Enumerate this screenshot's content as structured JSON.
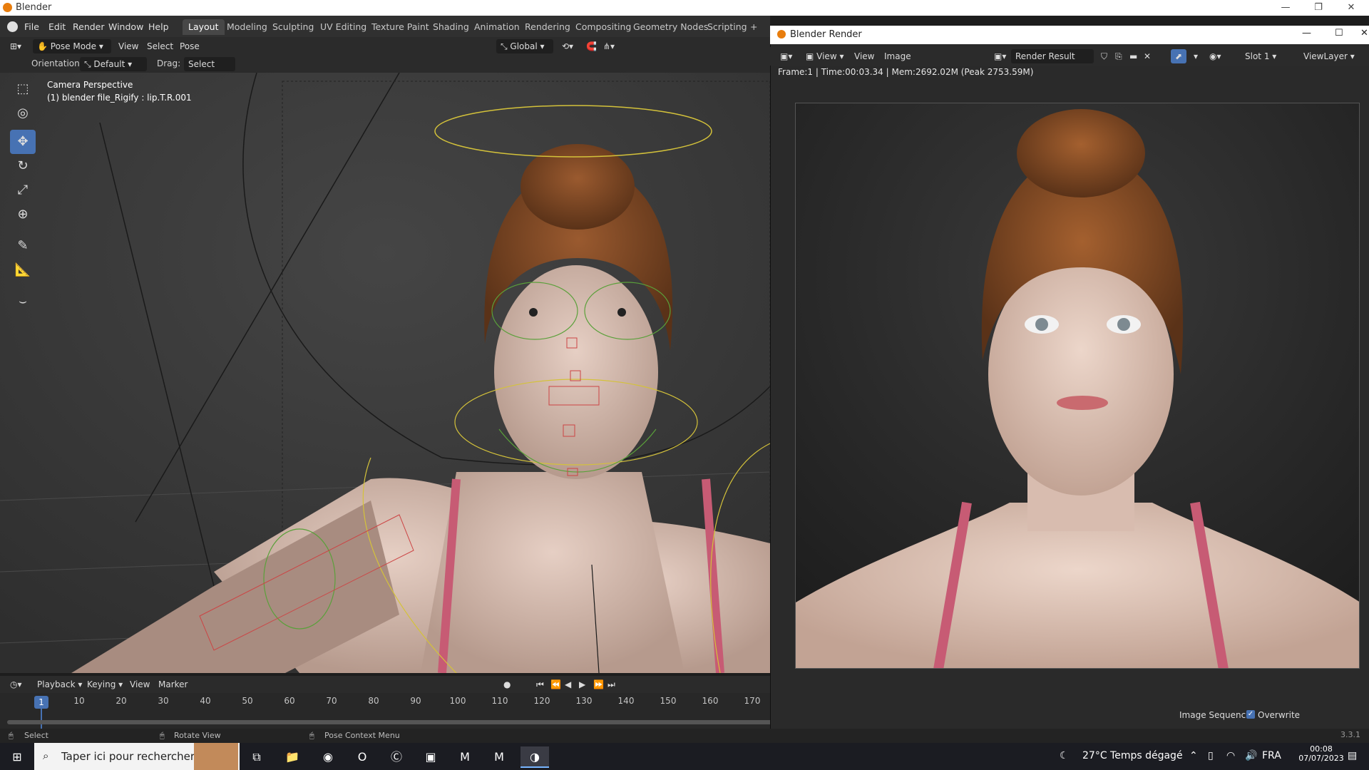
{
  "os": {
    "window_title": "Blender",
    "controls": [
      "—",
      "❐",
      "✕"
    ]
  },
  "menubar": {
    "items": [
      "File",
      "Edit",
      "Render",
      "Window",
      "Help"
    ],
    "workspaces": [
      "Layout",
      "Modeling",
      "Sculpting",
      "UV Editing",
      "Texture Paint",
      "Shading",
      "Animation",
      "Rendering",
      "Compositing",
      "Geometry Nodes",
      "Scripting",
      "+"
    ],
    "active_workspace": "Layout"
  },
  "viewport_header": {
    "mode": "Pose Mode",
    "menus": [
      "View",
      "Select",
      "Pose"
    ],
    "transform": "Global"
  },
  "viewport_tools_bar": {
    "orientation_label": "Orientation:",
    "orientation_value": "Default",
    "drag_label": "Drag:",
    "drag_value": "Select Box"
  },
  "viewport": {
    "info_line1": "Camera Perspective",
    "info_line2": "(1) blender file_Rigify : lip.T.R.001",
    "accent": "#4772b3",
    "bg": "#3a3a3a"
  },
  "toolbar": {
    "tools": [
      {
        "icon": "select-box-icon",
        "glyph": "⬚",
        "active": false
      },
      {
        "icon": "cursor-icon",
        "glyph": "◎",
        "active": false
      },
      {
        "icon": "move-icon",
        "glyph": "✥",
        "active": true
      },
      {
        "icon": "rotate-icon",
        "glyph": "↻",
        "active": false
      },
      {
        "icon": "scale-icon",
        "glyph": "⤢",
        "active": false
      },
      {
        "icon": "transform-icon",
        "glyph": "⊕",
        "active": false
      },
      {
        "icon": "annotate-icon",
        "glyph": "✎",
        "active": false
      },
      {
        "icon": "measure-icon",
        "glyph": "📐",
        "active": false
      },
      {
        "icon": "bone-relax-icon",
        "glyph": "⌣",
        "active": false
      }
    ]
  },
  "timeline": {
    "menus": [
      "Playback",
      "Keying",
      "View",
      "Marker"
    ],
    "current_frame": "1",
    "frames": [
      "10",
      "20",
      "30",
      "40",
      "50",
      "60",
      "70",
      "80",
      "90",
      "100",
      "110",
      "120",
      "130",
      "140",
      "150",
      "160",
      "170"
    ],
    "controls": [
      "⏮",
      "⏪",
      "◀",
      "▶",
      "⏩",
      "⏭"
    ]
  },
  "statusbar": {
    "select": "Select",
    "rotate": "Rotate View",
    "context": "Pose Context Menu",
    "version": "3.3.1"
  },
  "render_window": {
    "title": "Blender Render",
    "menus": [
      "View",
      "View",
      "Image"
    ],
    "result": "Render Result",
    "slot": "Slot 1",
    "view_layer": "ViewLayer",
    "info": "Frame:1 | Time:00:03.34 | Mem:2692.02M (Peak 2753.59M)",
    "image_sequence": "Image Sequence",
    "overwrite": "Overwrite"
  },
  "taskbar": {
    "search_placeholder": "Taper ici pour rechercher",
    "weather": "27°C  Temps dégagé",
    "lang": "FRA",
    "time": "00:08",
    "date": "07/07/2023"
  }
}
